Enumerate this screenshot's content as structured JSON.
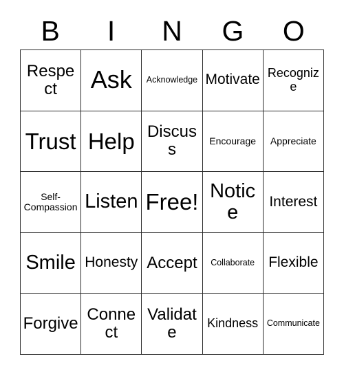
{
  "card": {
    "header_letters": [
      "B",
      "I",
      "N",
      "G",
      "O"
    ],
    "columns": 5,
    "rows": 5,
    "background_color": "#ffffff",
    "text_color": "#000000",
    "border_color": "#2b2b2b",
    "free_space_label": "Free!",
    "free_space_position": {
      "row": 3,
      "column": 3
    }
  },
  "grid": [
    [
      {
        "label": "Respect",
        "size": "fs-m"
      },
      {
        "label": "Ask",
        "size": "fs-xxl"
      },
      {
        "label": "Acknowledge",
        "size": "fs-min"
      },
      {
        "label": "Motivate",
        "size": "fs-s"
      },
      {
        "label": "Recognize",
        "size": "fs-xs"
      }
    ],
    [
      {
        "label": "Trust",
        "size": "fs-xl"
      },
      {
        "label": "Help",
        "size": "fs-xl"
      },
      {
        "label": "Discuss",
        "size": "fs-m"
      },
      {
        "label": "Encourage",
        "size": "fs-xxs"
      },
      {
        "label": "Appreciate",
        "size": "fs-xxs"
      }
    ],
    [
      {
        "label": "Self-Compassion",
        "size": "fs-xxs"
      },
      {
        "label": "Listen",
        "size": "fs-l"
      },
      {
        "label": "Free!",
        "size": "fs-xl"
      },
      {
        "label": "Notice",
        "size": "fs-l"
      },
      {
        "label": "Interest",
        "size": "fs-s"
      }
    ],
    [
      {
        "label": "Smile",
        "size": "fs-l"
      },
      {
        "label": "Honesty",
        "size": "fs-s"
      },
      {
        "label": "Accept",
        "size": "fs-m"
      },
      {
        "label": "Collaborate",
        "size": "fs-min"
      },
      {
        "label": "Flexible",
        "size": "fs-s"
      }
    ],
    [
      {
        "label": "Forgive",
        "size": "fs-m"
      },
      {
        "label": "Connect",
        "size": "fs-m"
      },
      {
        "label": "Validate",
        "size": "fs-m"
      },
      {
        "label": "Kindness",
        "size": "fs-xs"
      },
      {
        "label": "Communicate",
        "size": "fs-min"
      }
    ]
  ]
}
